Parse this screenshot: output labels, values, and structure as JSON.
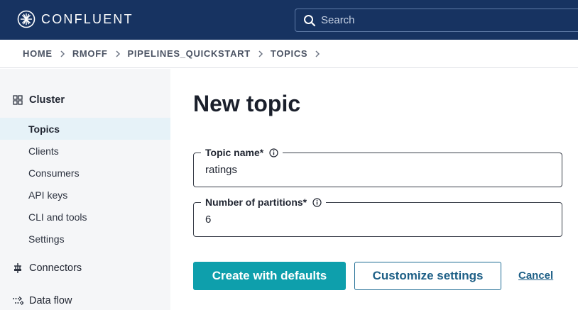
{
  "brand": {
    "name": "CONFLUENT"
  },
  "search": {
    "placeholder": "Search"
  },
  "breadcrumb": [
    "HOME",
    "RMOFF",
    "PIPELINES_QUICKSTART",
    "TOPICS"
  ],
  "sidebar": {
    "cluster_label": "Cluster",
    "items": [
      "Topics",
      "Clients",
      "Consumers",
      "API keys",
      "CLI and tools",
      "Settings"
    ],
    "active_item": "Topics",
    "connectors_label": "Connectors",
    "dataflow_label": "Data flow"
  },
  "main": {
    "title": "New topic",
    "topic_name": {
      "label": "Topic name*",
      "value": "ratings"
    },
    "partitions": {
      "label": "Number of partitions*",
      "value": "6"
    },
    "create_button": "Create with defaults",
    "customize_button": "Customize settings",
    "cancel_link": "Cancel"
  },
  "colors": {
    "topbar": "#173361",
    "primary": "#0e9fac",
    "link": "#1d5f86",
    "active_bg": "#e6f2f8"
  },
  "icons": [
    "confluent-logo-icon",
    "search-icon",
    "cluster-grid-icon",
    "connectors-icon",
    "dataflow-icon",
    "info-icon",
    "chevron-right-icon"
  ]
}
